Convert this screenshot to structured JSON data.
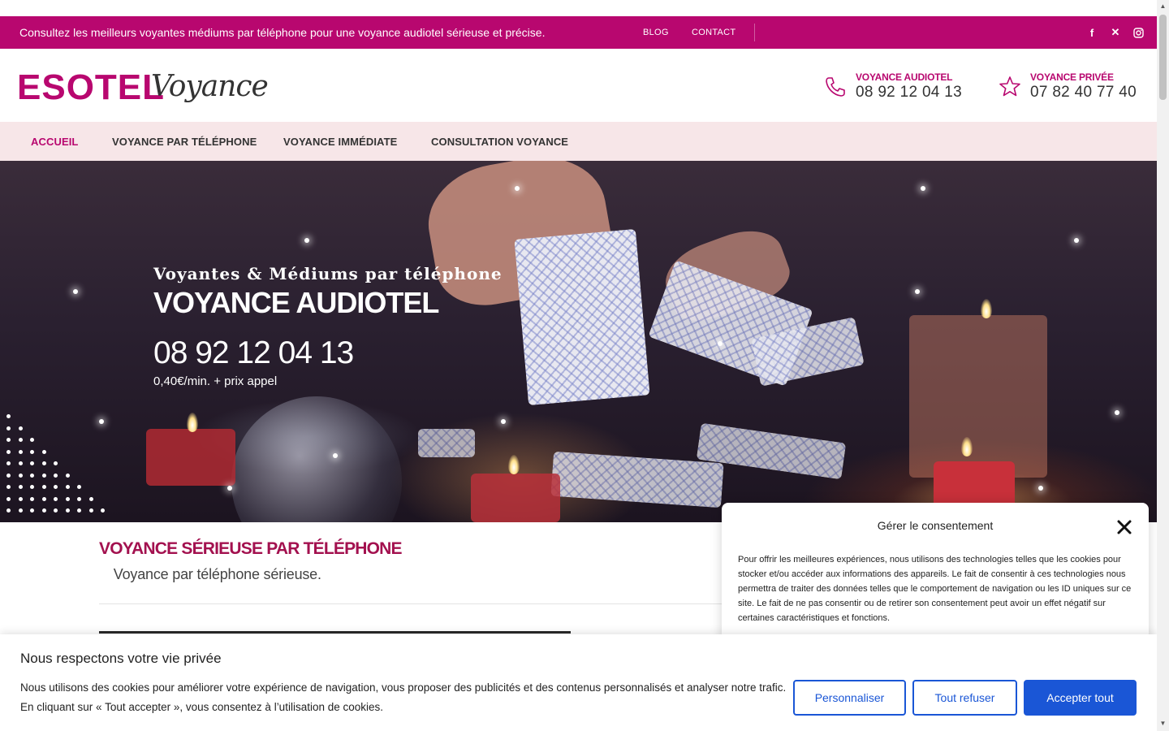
{
  "topbar": {
    "promo": " Consultez les meilleurs voyantes médiums par téléphone pour une voyance audiotel sérieuse et précise.  ",
    "links": [
      {
        "label": "BLOG"
      },
      {
        "label": "CONTACT"
      }
    ],
    "social": [
      {
        "icon": "facebook-icon",
        "glyph": "f"
      },
      {
        "icon": "x-twitter-icon",
        "glyph": "✕"
      },
      {
        "icon": "instagram-icon",
        "glyph": "▣"
      }
    ],
    "bg_color": "#b8076f"
  },
  "header": {
    "logo_main": "ESOTEL",
    "logo_script": "Voyance",
    "contacts": [
      {
        "icon": "phone-icon",
        "label": "VOYANCE AUDIOTEL",
        "number": "08 92 12 04 13"
      },
      {
        "icon": "star-icon",
        "label": "VOYANCE PRIVÉE",
        "number": "07 82 40 77 40"
      }
    ]
  },
  "nav": {
    "items": [
      {
        "label": "ACCUEIL",
        "active": true
      },
      {
        "label": "VOYANCE PAR TÉLÉPHONE",
        "active": false
      },
      {
        "label": "VOYANCE IMMÉDIATE",
        "active": false
      },
      {
        "label": "CONSULTATION VOYANCE",
        "active": false
      }
    ]
  },
  "hero": {
    "subtitle": "Voyantes & Médiums par téléphone",
    "title": "VOYANCE AUDIOTEL",
    "phone": "08 92 12 04 13",
    "price": "0,40€/min. + prix appel"
  },
  "main": {
    "section_title": "VOYANCE SÉRIEUSE PAR TÉLÉPHONE",
    "section_sub": " Voyance par téléphone sérieuse."
  },
  "consent_modal": {
    "title": "Gérer le consentement",
    "body": "Pour offrir les meilleures expériences, nous utilisons des technologies telles que les cookies pour stocker et/ou accéder aux informations des appareils. Le fait de consentir à ces technologies nous permettra de traiter des données telles que le comportement de navigation ou les ID uniques sur ce site. Le fait de ne pas consentir ou de retirer son consentement peut avoir un effet négatif sur certaines caractéristiques et fonctions."
  },
  "cookie_bar": {
    "title": "Nous respectons votre vie privée",
    "text": "Nous utilisons des cookies pour améliorer votre expérience de navigation, vous proposer des publicités et des contenus personnalisés et analyser notre trafic. En cliquant sur « Tout accepter », vous consentez à l’utilisation de cookies.",
    "buttons": [
      {
        "label": "Personnaliser"
      },
      {
        "label": "Tout refuser"
      },
      {
        "label": "Accepter tout"
      }
    ],
    "accent_color": "#1a56d6"
  },
  "colors": {
    "brand": "#b8076f",
    "section_title": "#a3114f",
    "nav_bg": "#f7e6e8"
  }
}
